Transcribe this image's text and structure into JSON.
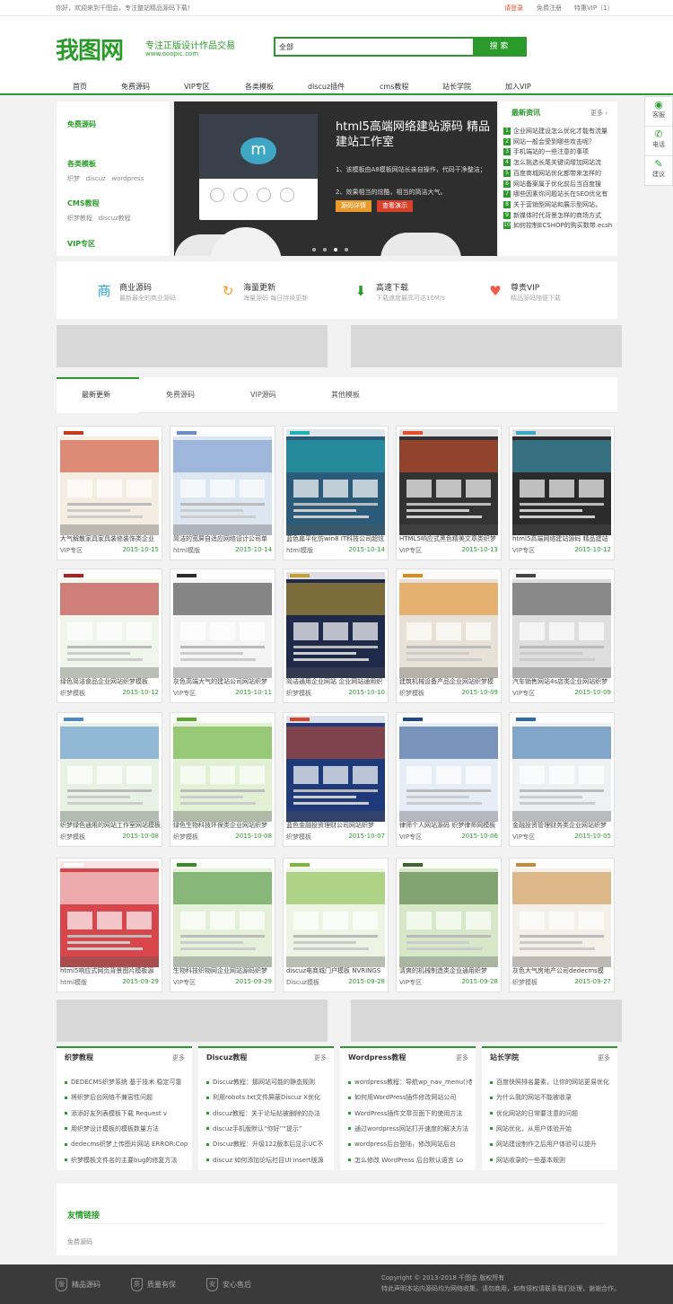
{
  "topbar": {
    "welcome": "你好，欢迎来到千图会，专注整站精品源码下载！",
    "login": "请登录",
    "register": "免费注册",
    "vip": "特惠VIP（1）"
  },
  "header": {
    "logo": "我图网",
    "slogan": "专注正版设计作品交易",
    "url": "www.ooopic.com",
    "search_cat": "全部",
    "search_btn": "搜 索"
  },
  "nav": [
    "首页",
    "免费源码",
    "VIP专区",
    "各类模板",
    "discuz插件",
    "cms教程",
    "站长学院",
    "加入VIP"
  ],
  "categories": [
    {
      "title": "免费源码",
      "subs": []
    },
    {
      "title": "各类模板",
      "subs": [
        "织梦",
        "discuz",
        "wordpress"
      ]
    },
    {
      "title": "CMS教程",
      "subs": [
        "织梦教程",
        "discuz教程"
      ]
    },
    {
      "title": "VIP专区",
      "subs": []
    }
  ],
  "banner": {
    "title": "html5高端网络建站源码 精品建站工作室",
    "point1": "1、该模板由A8模板网站长亲自操作，代码干净整洁；",
    "point2": "2、效果相当的炫酷，相当的简洁大气。",
    "btn1": "源码详情",
    "btn2": "查看演示"
  },
  "news": {
    "title": "最新资讯",
    "more": "更多",
    "items": [
      {
        "n": "1",
        "t": "企业网站建设怎么优化才能有流量"
      },
      {
        "n": "2",
        "t": "网站一般会受到哪些攻击呢？"
      },
      {
        "n": "3",
        "t": "手机端站的一些注意的事项"
      },
      {
        "n": "4",
        "t": "怎么挑选长尾关键词增加网站流"
      },
      {
        "n": "5",
        "t": "百度商城网站优化都带来怎样的"
      },
      {
        "n": "6",
        "t": "网站备案属于优化前后当百度搜"
      },
      {
        "n": "7",
        "t": "哪些因素你问题站长在SEO优化有"
      },
      {
        "n": "8",
        "t": "关于营销型网站和展示型网站，"
      },
      {
        "n": "9",
        "t": "新媒体时代背景怎样的商场方式"
      },
      {
        "n": "10",
        "t": "如何控制ECSHOP的购买数带.ecsh"
      }
    ]
  },
  "side": [
    "客服",
    "电话",
    "建议"
  ],
  "features": [
    {
      "icon": "商",
      "t": "商业源码",
      "d": "最新最全的商业源码",
      "color": "#29a0d8"
    },
    {
      "icon": "↻",
      "t": "海量更新",
      "d": "海量源码 每日持续更新",
      "color": "#f39a1e"
    },
    {
      "icon": "⬇",
      "t": "高速下载",
      "d": "下载速度最高可达10M/s",
      "color": "#2a9b2a"
    },
    {
      "icon": "♥",
      "t": "尊贵VIP",
      "d": "精品源码随便下载",
      "color": "#ef5a4a"
    }
  ],
  "tabs": [
    "最新更新",
    "免费源码",
    "VIP源码",
    "其他模板"
  ],
  "cards": [
    {
      "t": "大气解散家具家具装修装饰类企业",
      "c": "VIP专区",
      "d": "2015-10-15",
      "bg": "#f5ece2",
      "ac": "#c83a1e"
    },
    {
      "t": "简洁的宽屏自适应网络设计公司单",
      "c": "html模版",
      "d": "2015-10-14",
      "bg": "#dde7f2",
      "ac": "#6a8fc8"
    },
    {
      "t": "蓝色扁平化仿win8 IT科技公司超炫",
      "c": "html模版",
      "d": "2015-10-14",
      "bg": "#2a5b7a",
      "ac": "#1fb0b8"
    },
    {
      "t": "HTML5响应式黑色精美文章类织梦",
      "c": "VIP专区",
      "d": "2015-10-13",
      "bg": "#333333",
      "ac": "#e0502a"
    },
    {
      "t": "html5高端网络建站源码 精品建站",
      "c": "VIP专区",
      "d": "2015-10-12",
      "bg": "#2b2b2b",
      "ac": "#3ea7c6"
    },
    {
      "t": "绿色简洁食品企业网站织梦模板",
      "c": "织梦模板",
      "d": "2015-10-12",
      "bg": "#f1f6ec",
      "ac": "#b01e1e"
    },
    {
      "t": "灰色高端大气的建站公司网站织梦",
      "c": "VIP专区",
      "d": "2015-10-11",
      "bg": "#f4f4f4",
      "ac": "#2a2a2a"
    },
    {
      "t": "简洁通用企业网站 企业网站通用织",
      "c": "织梦模板",
      "d": "2015-10-10",
      "bg": "#1f2a4a",
      "ac": "#c8a030"
    },
    {
      "t": "建筑机械设备产品企业网站织梦模",
      "c": "织梦模板",
      "d": "2015-10-09",
      "bg": "#e8e1d8",
      "ac": "#e08a1e"
    },
    {
      "t": "汽车销售网站4s店类企业网站织梦",
      "c": "VIP专区",
      "d": "2015-10-09",
      "bg": "#dedede",
      "ac": "#444444"
    },
    {
      "t": "织梦绿色通用的网站工作室网站模板",
      "c": "织梦模板",
      "d": "2015-10-08",
      "bg": "#e7f2e4",
      "ac": "#4a8ac8"
    },
    {
      "t": "绿色生物科技环保类企业网站织梦",
      "c": "织梦模板",
      "d": "2015-10-08",
      "bg": "#e2f0d4",
      "ac": "#5aaa2a"
    },
    {
      "t": "蓝色金融投资理财公司网站织梦",
      "c": "织梦模板",
      "d": "2015-10-07",
      "bg": "#1e3a7a",
      "ac": "#d04a2a"
    },
    {
      "t": "律师个人网站源码 织梦律师网模板",
      "c": "VIP专区",
      "d": "2015-10-06",
      "bg": "#e6edf6",
      "ac": "#1f4a8a"
    },
    {
      "t": "金融投资管理财务类企业网站织梦",
      "c": "VIP专区",
      "d": "2015-10-05",
      "bg": "#eef0f2",
      "ac": "#2a6aa8"
    },
    {
      "t": "html5响应式网页背景图片模板源",
      "c": "html模版",
      "d": "2015-09-29",
      "bg": "#d8454a",
      "ac": "#ffffff"
    },
    {
      "t": "生物科技织物网企业网站源码织梦",
      "c": "VIP专区",
      "d": "2015-09-29",
      "bg": "#e4f0da",
      "ac": "#3a8a2a"
    },
    {
      "t": "discuz电商城门户模板 NVRINGS",
      "c": "Discuz模板",
      "d": "2015-09-28",
      "bg": "#eef4e4",
      "ac": "#7ab83a"
    },
    {
      "t": "清爽的机械制造类企业通用织梦",
      "c": "VIP专区",
      "d": "2015-09-28",
      "bg": "#d6e8c8",
      "ac": "#3a6a2a"
    },
    {
      "t": "灰色大气房地产公司dedecms模",
      "c": "织梦模板",
      "d": "2015-09-27",
      "bg": "#f4efe8",
      "ac": "#c88a3a"
    }
  ],
  "columns": [
    {
      "h": "织梦教程",
      "m": "更多",
      "rows": [
        "DEDECMS织梦系统 基于技术 稳定可靠",
        "将织梦后台网络不兼容性问题",
        "添添好友列表模板下载 Request v",
        "用织梦设计模板的模板数量方法",
        "dedecms织梦上传图片网站 ERROR:Copy U",
        "织梦模板文件名的主要bug的修复方法"
      ]
    },
    {
      "h": "Discuz教程",
      "m": "更多",
      "rows": [
        "Discuz教程：那网站可能的静态规则",
        "利用robots.txt文件屏蔽Discuz X优化",
        "discuz教程：关于论坛帖被删除的办法",
        "discuz手机版默认“你好”“提示”",
        "Discuz教程：升级122版本后显示UC不",
        "discuz 如何添加论坛栏目UI insert版源"
      ]
    },
    {
      "h": "Wordpress教程",
      "m": "更多",
      "rows": [
        "wordpress教程：导航wp_nav_menu()参数",
        "如何用WordPress插件修改网站公司",
        "WordPress插件文章页面下的使用方法",
        "通过wordpress网站打开速度的解决方法",
        "wordpress后台登陆，修改网站后台",
        "怎么修改 WordPress 后台默认语言 Lo"
      ]
    },
    {
      "h": "站长学院",
      "m": "更多",
      "rows": [
        "百度快照排名要素，让你的网站更易优化",
        "为什么我的网站不能被收录",
        "优化网站的日常要注意的问题",
        "网站优化，从用户体验开始",
        "网站建设制作之后用户体验可以提升",
        "网站收录的一些基本规则"
      ]
    }
  ],
  "links": {
    "h": "友情链接",
    "item": "免费源码"
  },
  "footer": {
    "b1": "精品源码",
    "b2": "质量有保",
    "b3": "安心售后",
    "copy1": "Copyright © 2013-2018 千图会 版权所有",
    "copy2": "特此声明本站内源码均为网络收集，请勿商用，如有侵权请联系我们处理，谢谢合作。"
  }
}
